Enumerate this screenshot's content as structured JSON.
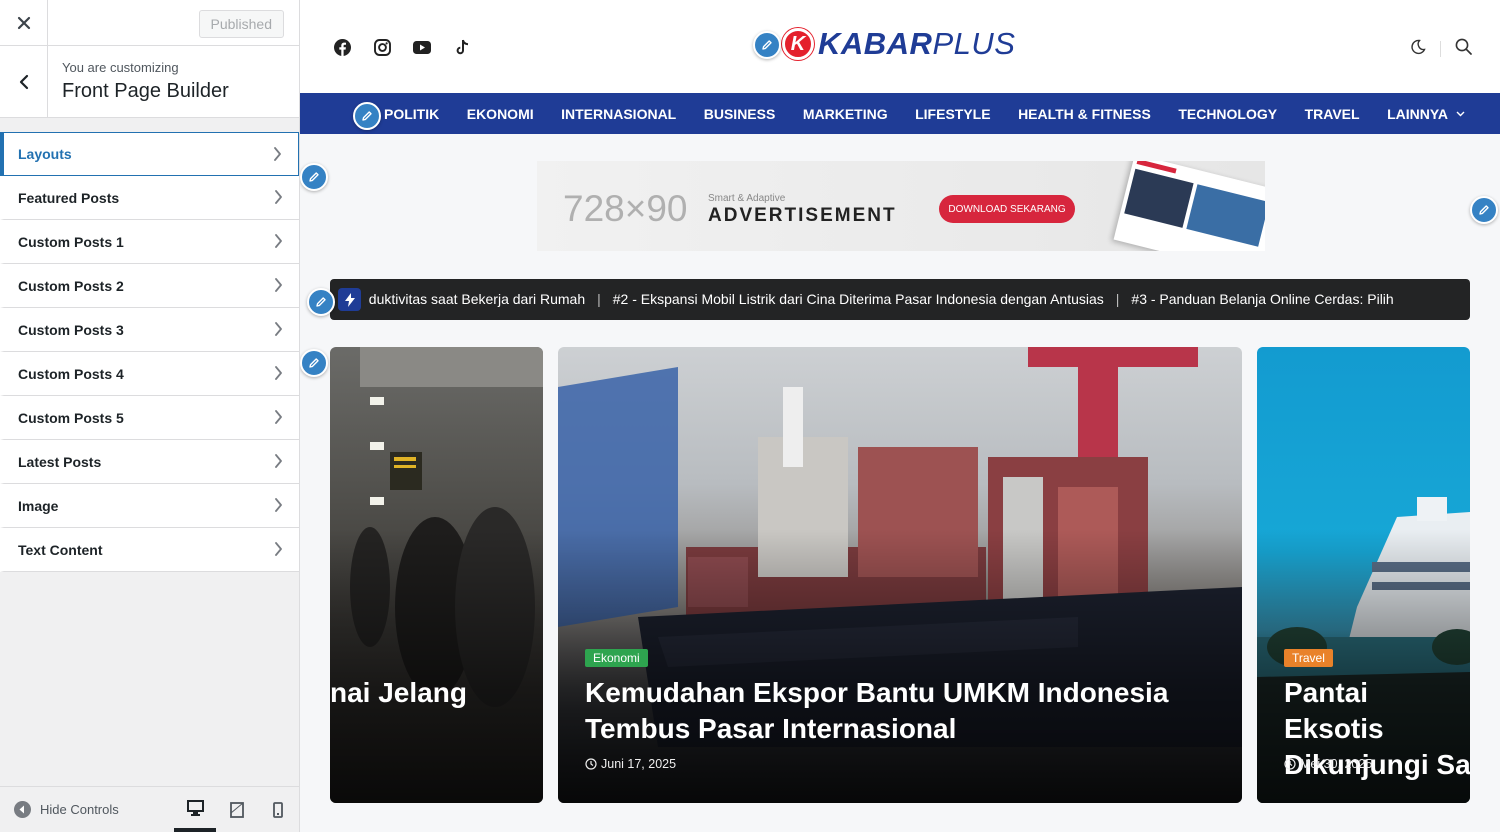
{
  "customizer": {
    "publish_label": "Published",
    "customizing_label": "You are customizing",
    "section_title": "Front Page Builder",
    "sections": [
      {
        "label": "Layouts",
        "active": true
      },
      {
        "label": "Featured Posts"
      },
      {
        "label": "Custom Posts 1"
      },
      {
        "label": "Custom Posts 2"
      },
      {
        "label": "Custom Posts 3"
      },
      {
        "label": "Custom Posts 4"
      },
      {
        "label": "Custom Posts 5"
      },
      {
        "label": "Latest Posts"
      },
      {
        "label": "Image"
      },
      {
        "label": "Text Content"
      }
    ],
    "hide_controls_label": "Hide Controls",
    "preview_devices": [
      "desktop",
      "tablet",
      "mobile"
    ],
    "active_device": "desktop"
  },
  "site": {
    "logo": {
      "letter": "K",
      "name_bold": "KABAR",
      "name_light": "PLUS"
    },
    "social_icons": [
      "facebook-icon",
      "instagram-icon",
      "youtube-icon",
      "tiktok-icon"
    ],
    "nav": [
      {
        "label": "POLITIK"
      },
      {
        "label": "EKONOMI"
      },
      {
        "label": "INTERNASIONAL"
      },
      {
        "label": "BUSINESS"
      },
      {
        "label": "MARKETING"
      },
      {
        "label": "LIFESTYLE"
      },
      {
        "label": "HEALTH & FITNESS"
      },
      {
        "label": "TECHNOLOGY"
      },
      {
        "label": "TRAVEL"
      },
      {
        "label": "LAINNYA",
        "has_dropdown": true
      }
    ],
    "ad": {
      "size_text": "728×90",
      "tagline": "Smart & Adaptive",
      "headline": "ADVERTISEMENT",
      "cta": "DOWNLOAD SEKARANG"
    },
    "ticker_items": [
      "Produktivitas saat Bekerja dari Rumah",
      "#2 - Ekspansi Mobil Listrik dari Cina Diterima Pasar Indonesia dengan Antusias",
      "#3 - Panduan Belanja Online Cerdas: Pilih"
    ],
    "slides": [
      {
        "title": "nai Jelang",
        "category": "",
        "date": ""
      },
      {
        "title": "Kemudahan Ekspor Bantu UMKM Indonesia Tembus Pasar Internasional",
        "category": "Ekonomi",
        "category_color": "#2ea44f",
        "date": "Juni 17, 2025"
      },
      {
        "title": "Pantai Eksotis Dikunjungi Sa",
        "category": "Travel",
        "category_color": "#e9822a",
        "date": "Mei 30, 2025"
      }
    ]
  },
  "colors": {
    "brand_blue": "#1f3c96",
    "wp_blue": "#2271b1",
    "ad_red": "#d7263d"
  }
}
